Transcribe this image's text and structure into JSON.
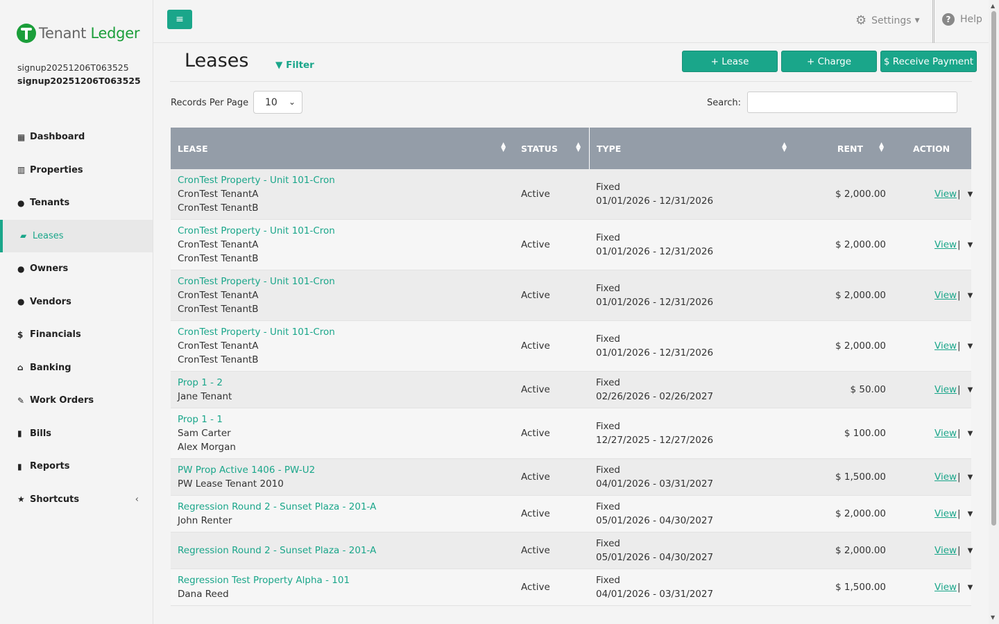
{
  "brand": {
    "word1": "Tenant",
    "word2": "Ledger"
  },
  "user": {
    "line1": "signup20251206T063525",
    "line2": "signup20251206T063525"
  },
  "nav": [
    {
      "icon": "dashboard-icon",
      "glyph": "▦",
      "label": "Dashboard"
    },
    {
      "icon": "building-icon",
      "glyph": "▥",
      "label": "Properties"
    },
    {
      "icon": "user-icon",
      "glyph": "●",
      "label": "Tenants"
    },
    {
      "icon": "folder-open-icon",
      "glyph": "▰",
      "label": "Leases",
      "active": true
    },
    {
      "icon": "users-icon",
      "glyph": "●",
      "label": "Owners"
    },
    {
      "icon": "users-icon",
      "glyph": "●",
      "label": "Vendors"
    },
    {
      "icon": "dollar-icon",
      "glyph": "$",
      "label": "Financials"
    },
    {
      "icon": "bank-icon",
      "glyph": "⌂",
      "label": "Banking"
    },
    {
      "icon": "edit-icon",
      "glyph": "✎",
      "label": "Work Orders"
    },
    {
      "icon": "file-icon",
      "glyph": "▮",
      "label": "Bills"
    },
    {
      "icon": "file-icon",
      "glyph": "▮",
      "label": "Reports"
    },
    {
      "icon": "star-icon",
      "glyph": "★",
      "label": "Shortcuts",
      "chevron": "‹"
    }
  ],
  "topbar": {
    "settings_label": "Settings",
    "help_label": "Help"
  },
  "page": {
    "title": "Leases",
    "filter_label": "Filter",
    "buttons": {
      "lease": "+ Lease",
      "charge": "+ Charge",
      "receive_payment": "$ Receive Payment"
    },
    "records_per_page_label": "Records Per Page",
    "records_per_page_value": "10",
    "search_label": "Search:",
    "search_value": ""
  },
  "table": {
    "headers": {
      "lease": "LEASE",
      "status": "STATUS",
      "type": "TYPE",
      "rent": "RENT",
      "action": "ACTION"
    },
    "rows": [
      {
        "property": "CronTest Property - Unit 101-Cron",
        "tenants": [
          "CronTest TenantA",
          "CronTest TenantB"
        ],
        "status": "Active",
        "type": "Fixed",
        "dates": "01/01/2026 - 12/31/2026",
        "rent": "$ 2,000.00",
        "action": "View"
      },
      {
        "property": "CronTest Property - Unit 101-Cron",
        "tenants": [
          "CronTest TenantA",
          "CronTest TenantB"
        ],
        "status": "Active",
        "type": "Fixed",
        "dates": "01/01/2026 - 12/31/2026",
        "rent": "$ 2,000.00",
        "action": "View"
      },
      {
        "property": "CronTest Property - Unit 101-Cron",
        "tenants": [
          "CronTest TenantA",
          "CronTest TenantB"
        ],
        "status": "Active",
        "type": "Fixed",
        "dates": "01/01/2026 - 12/31/2026",
        "rent": "$ 2,000.00",
        "action": "View"
      },
      {
        "property": "CronTest Property - Unit 101-Cron",
        "tenants": [
          "CronTest TenantA",
          "CronTest TenantB"
        ],
        "status": "Active",
        "type": "Fixed",
        "dates": "01/01/2026 - 12/31/2026",
        "rent": "$ 2,000.00",
        "action": "View"
      },
      {
        "property": "Prop 1 - 2",
        "tenants": [
          "Jane Tenant"
        ],
        "status": "Active",
        "type": "Fixed",
        "dates": "02/26/2026 - 02/26/2027",
        "rent": "$ 50.00",
        "action": "View"
      },
      {
        "property": "Prop 1 - 1",
        "tenants": [
          "Sam Carter",
          "Alex Morgan"
        ],
        "status": "Active",
        "type": "Fixed",
        "dates": "12/27/2025 - 12/27/2026",
        "rent": "$ 100.00",
        "action": "View"
      },
      {
        "property": "PW Prop Active 1406 - PW-U2",
        "tenants": [
          "PW Lease Tenant 2010"
        ],
        "status": "Active",
        "type": "Fixed",
        "dates": "04/01/2026 - 03/31/2027",
        "rent": "$ 1,500.00",
        "action": "View"
      },
      {
        "property": "Regression Round 2 - Sunset Plaza - 201-A",
        "tenants": [
          "John Renter"
        ],
        "status": "Active",
        "type": "Fixed",
        "dates": "05/01/2026 - 04/30/2027",
        "rent": "$ 2,000.00",
        "action": "View"
      },
      {
        "property": "Regression Round 2 - Sunset Plaza - 201-A",
        "tenants": [],
        "status": "Active",
        "type": "Fixed",
        "dates": "05/01/2026 - 04/30/2027",
        "rent": "$ 2,000.00",
        "action": "View"
      },
      {
        "property": "Regression Test Property Alpha - 101",
        "tenants": [
          "Dana Reed"
        ],
        "status": "Active",
        "type": "Fixed",
        "dates": "04/01/2026 - 03/31/2027",
        "rent": "$ 1,500.00",
        "action": "View"
      }
    ]
  },
  "colors": {
    "accent": "#1aa68a",
    "header_bg": "#949da8",
    "brand_green": "#1b9e3a"
  }
}
